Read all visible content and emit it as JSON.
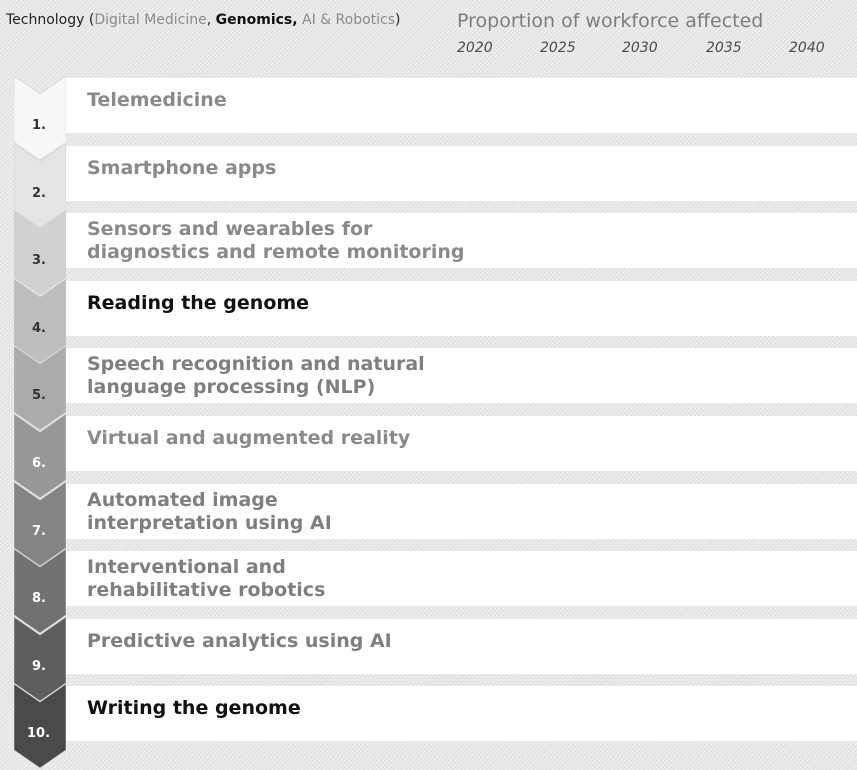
{
  "header": {
    "technology_prefix": "Technology (",
    "category_digital_medicine": "Digital Medicine",
    "sep1": ", ",
    "category_genomics": "Genomics,",
    "category_ai_robotics": " AI & Robotics",
    "technology_suffix": ")",
    "proportion_title": "Proportion of workforce affected"
  },
  "chart_data": {
    "type": "table",
    "title": "Proportion of workforce affected",
    "row_header": "Technology (Digital Medicine, Genomics, AI & Robotics)",
    "columns": [
      "2020",
      "2025",
      "2030",
      "2035",
      "2040"
    ],
    "categories": [
      "Digital Medicine",
      "Genomics",
      "AI & Robotics"
    ],
    "rows": [
      {
        "rank": "1.",
        "label": "Telemedicine",
        "category": "Digital Medicine"
      },
      {
        "rank": "2.",
        "label": "Smartphone apps",
        "category": "Digital Medicine"
      },
      {
        "rank": "3.",
        "label": "Sensors and wearables for\ndiagnostics and remote monitoring",
        "category": "Digital Medicine"
      },
      {
        "rank": "4.",
        "label": "Reading the genome",
        "category": "Genomics"
      },
      {
        "rank": "5.",
        "label": "Speech recognition and natural\nlanguage processing (NLP)",
        "category": "AI & Robotics"
      },
      {
        "rank": "6.",
        "label": "Virtual and augmented reality",
        "category": "Digital Medicine"
      },
      {
        "rank": "7.",
        "label": "Automated image\ninterpretation using AI",
        "category": "AI & Robotics"
      },
      {
        "rank": "8.",
        "label": "Interventional and\nrehabilitative robotics",
        "category": "AI & Robotics"
      },
      {
        "rank": "9.",
        "label": "Predictive analytics using AI",
        "category": "AI & Robotics"
      },
      {
        "rank": "10.",
        "label": "Writing the genome",
        "category": "Genomics"
      }
    ]
  },
  "colors": {
    "digital_medicine_text": "#8a8a8a",
    "genomics_text": "#111111",
    "ai_robotics_text": "#7f7f7f",
    "chevron_ramp_start": "#f8f8f8",
    "chevron_ramp_end": "#4a4a4a"
  }
}
